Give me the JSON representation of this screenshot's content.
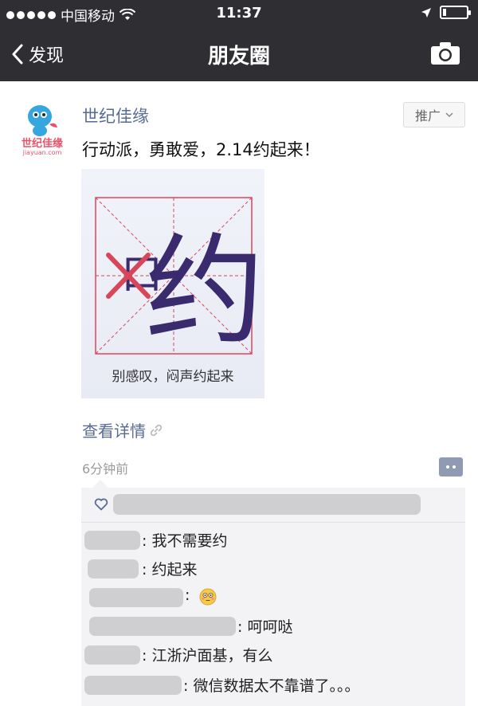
{
  "status_bar": {
    "carrier": "中国移动",
    "time": "11:37",
    "battery_level": 0.15
  },
  "nav": {
    "back_label": "发现",
    "title": "朋友圈",
    "right_icon": "camera-icon"
  },
  "post": {
    "author": "世纪佳缘",
    "avatar_logo": {
      "text": "世纪佳缘",
      "subtext": "jiayuan.com"
    },
    "promo_label": "推广",
    "text": "行动派，勇敢爱，2.14约起来！",
    "image": {
      "big_char": "约",
      "crossed_char": "口",
      "caption": "别感叹，闷声约起来"
    },
    "view_details": "查看详情",
    "time": "6分钟前"
  },
  "comments": [
    {
      "text": ": 我不需要约"
    },
    {
      "text": ": 约起来"
    },
    {
      "text": ":",
      "emoji": "flushed-face-emoji"
    },
    {
      "text": ": 呵呵哒"
    },
    {
      "text": ": 江浙沪面基，有么"
    },
    {
      "text": ": 微信数据太不靠谱了。。。"
    }
  ],
  "colors": {
    "bar_bg": "#2e2e33",
    "link": "#576b95",
    "comment_bg": "#f3f3f5",
    "redacted": "#cfcfd2",
    "grid_red": "#d9465a",
    "char_purple": "#3a2a6e"
  }
}
